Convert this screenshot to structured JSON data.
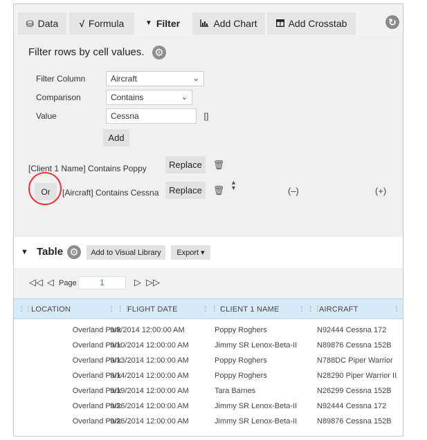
{
  "tabs": [
    {
      "icon": "database-icon",
      "glyph": "⛁",
      "label": "Data"
    },
    {
      "icon": "formula-icon",
      "glyph": "√",
      "label": "Formula"
    },
    {
      "icon": "filter-icon",
      "glyph": "▼",
      "label": "Filter"
    },
    {
      "icon": "chart-icon",
      "glyph": "▄",
      "label": "Add Chart"
    },
    {
      "icon": "crosstab-icon",
      "glyph": "⊞",
      "label": "Add Crosstab"
    }
  ],
  "active_tab": "Filter",
  "filter": {
    "title": "Filter rows by cell values.",
    "column_label": "Filter Column",
    "column_value": "Aircraft",
    "comparison_label": "Comparison",
    "comparison_value": "Contains",
    "value_label": "Value",
    "value_value": "Cessna",
    "brackets": "[]",
    "add_label": "Add",
    "rules": [
      {
        "text": "[Client 1 Name] Contains Poppy",
        "replace_label": "Replace"
      },
      {
        "prefix": "Or",
        "text": "[Aircraft] Contains Cessna",
        "replace_label": "Replace",
        "open_paren": "(–)",
        "close_paren": "(+)"
      }
    ]
  },
  "table": {
    "title": "Table",
    "add_to_library": "Add to Visual Library",
    "export": "Export ▾",
    "page_label": "Page",
    "page_value": "1",
    "columns": [
      "LOCATION",
      "FLIGHT DATE",
      "CLIENT 1 NAME",
      "AIRCRAFT"
    ],
    "rows": [
      [
        "Overland Park",
        "9/8/2014 12:00:00 AM",
        "Poppy Roghers",
        "N92444 Cessna 172"
      ],
      [
        "Overland Park",
        "9/10/2014 12:00:00 AM",
        "Jimmy SR Lenox-Beta-II",
        "N89876 Cessna 152B"
      ],
      [
        "Overland Park",
        "9/13/2014 12:00:00 AM",
        "Poppy Roghers",
        "N788DC Piper Warrior"
      ],
      [
        "Overland Park",
        "9/14/2014 12:00:00 AM",
        "Poppy Roghers",
        "N28290 Piper Warrior II"
      ],
      [
        "Overland Park",
        "9/19/2014 12:00:00 AM",
        "Tara Barnes",
        "N26299 Cessna 152B"
      ],
      [
        "Overland Park",
        "9/26/2014 12:00:00 AM",
        "Jimmy SR Lenox-Beta-II",
        "N92444 Cessna 172"
      ],
      [
        "Overland Park",
        "9/26/2014 12:00:00 AM",
        "Jimmy SR Lenox-Beta-II",
        "N89876 Cessna 152B"
      ]
    ]
  },
  "colors": {
    "accent": "#1a7fd0",
    "highlight_circle": "#e33333",
    "header_bg": "#d7eaf8"
  }
}
